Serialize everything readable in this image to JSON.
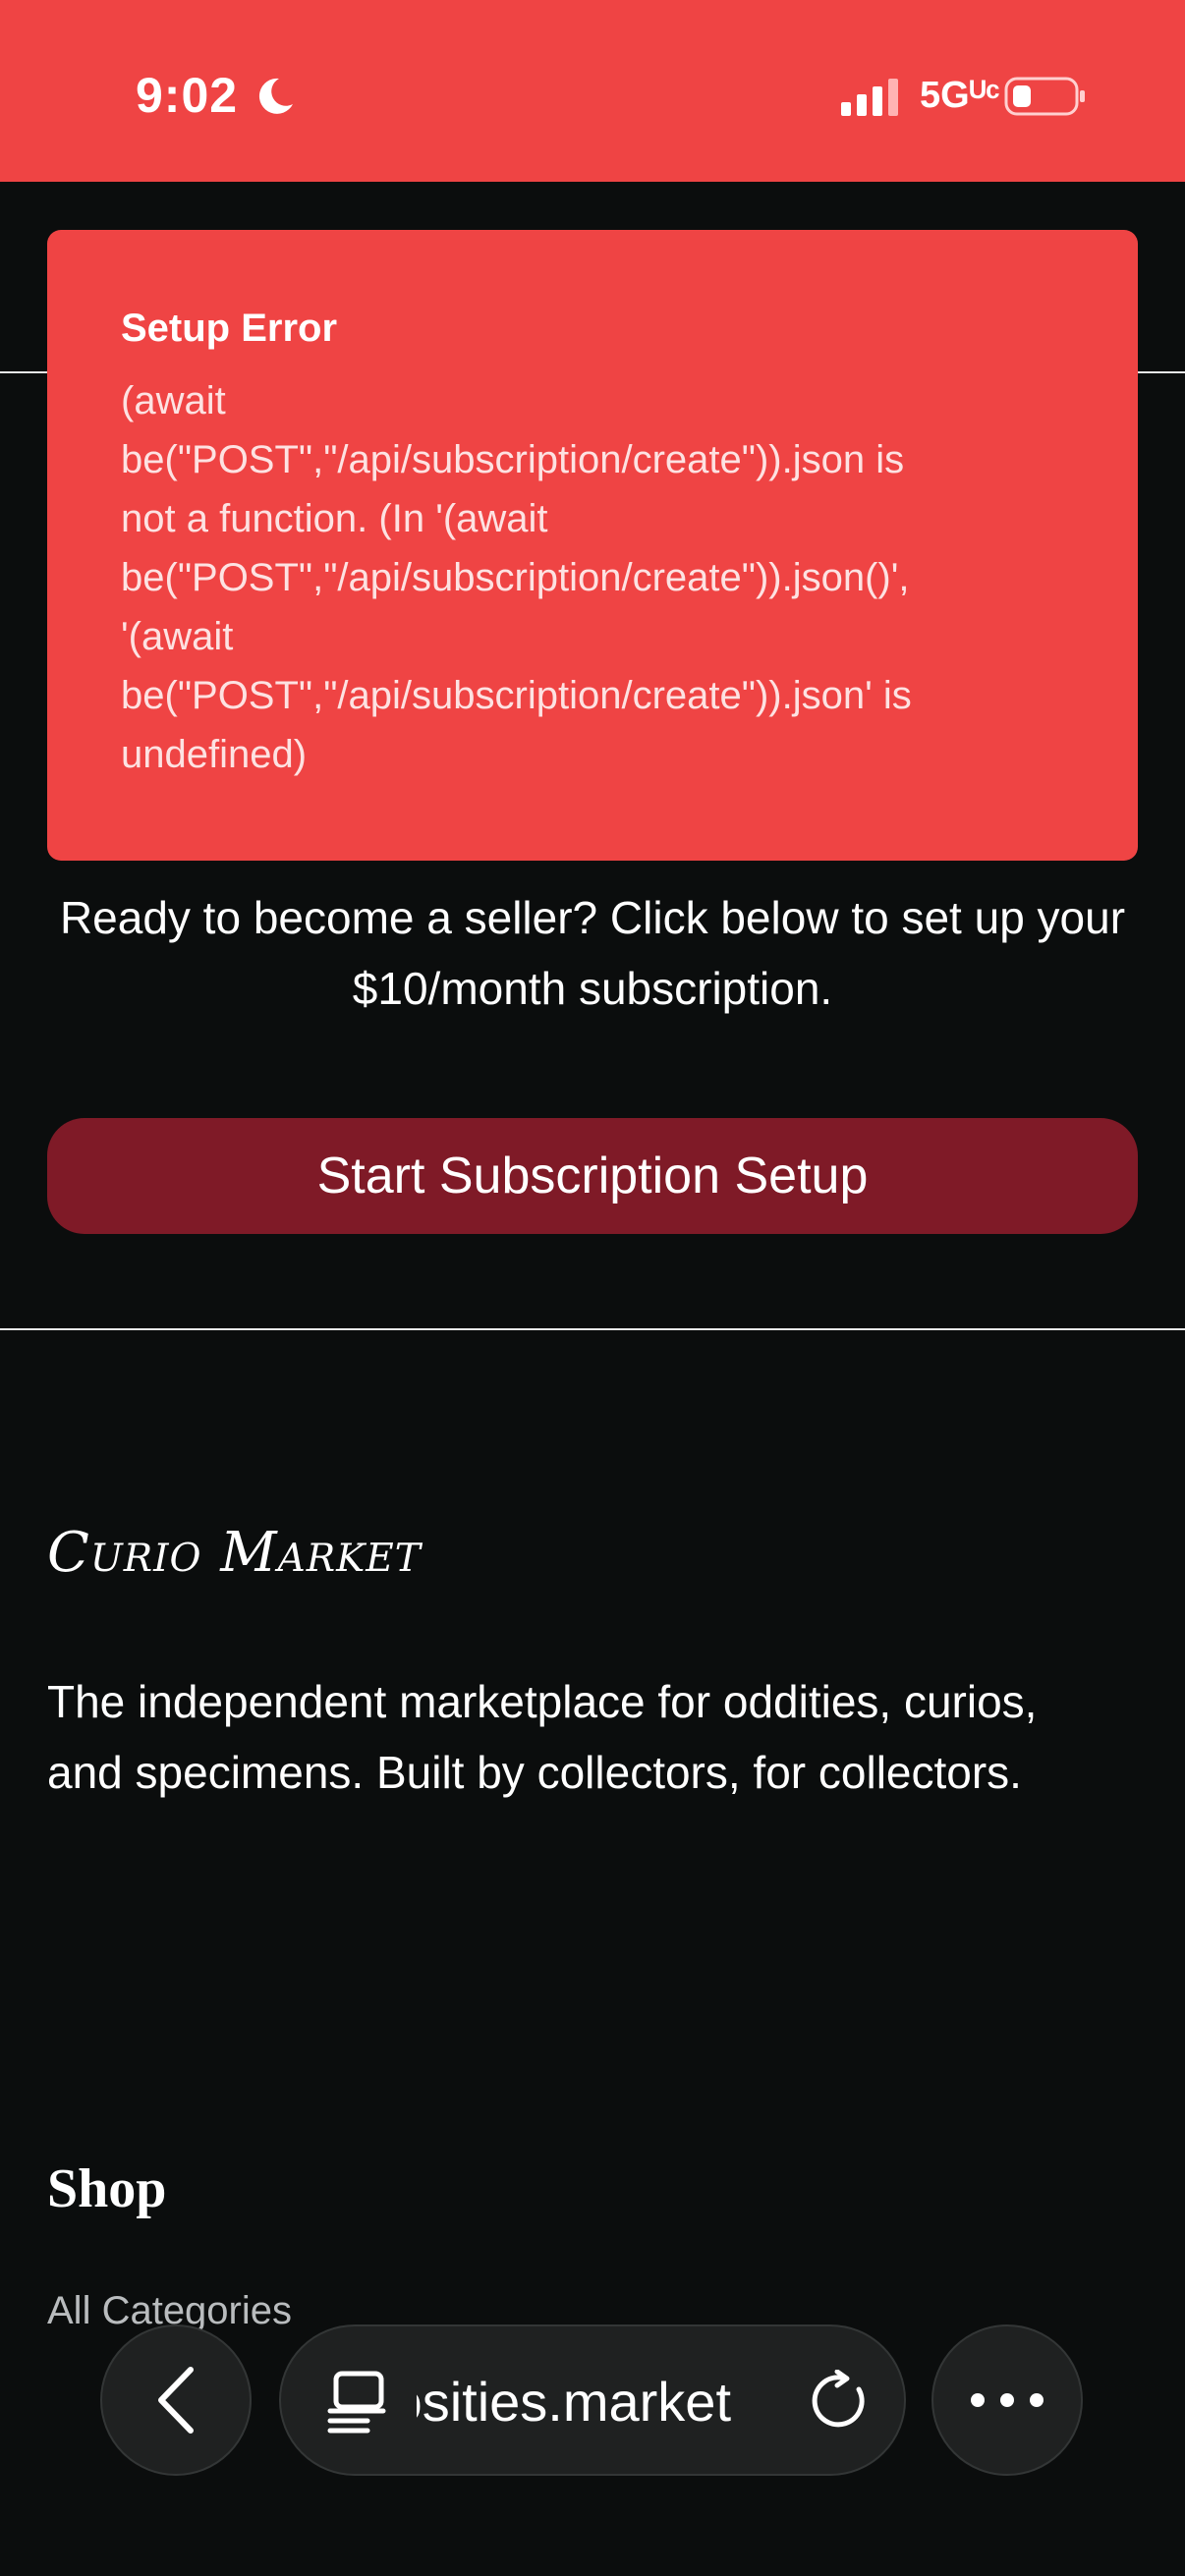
{
  "status_bar": {
    "time": "9:02",
    "network": "5Gᵁᶜ",
    "moon_icon": "moon-icon",
    "signal_icon": "signal-icon",
    "battery_icon": "battery-icon"
  },
  "error": {
    "title": "Setup Error",
    "message": "(await\nbe(\"POST\",\"/api/subscription/create\")).json is\nnot a function. (In '(await\nbe(\"POST\",\"/api/subscription/create\")).json()',\n'(await\nbe(\"POST\",\"/api/subscription/create\")).json' is\nundefined)"
  },
  "seller": {
    "intro": "Ready to become a seller? Click below to set up your $10/month subscription.",
    "button_label": "Start Subscription Setup"
  },
  "footer": {
    "brand": "Curio Market",
    "description": "The independent marketplace for oddities, curios, and specimens. Built by collectors, for collectors.",
    "shop_heading": "Shop",
    "shop_links": [
      "All Categories"
    ]
  },
  "browser": {
    "url": "curiosities.market",
    "visible_url": "osities.market",
    "back_icon": "chevron-left-icon",
    "tabs_icon": "tabs-icon",
    "reload_icon": "reload-icon",
    "more_icon": "more-dots-icon"
  },
  "colors": {
    "accent": "#ef4444",
    "button": "#7f1a27",
    "background": "#0b0d0d"
  }
}
